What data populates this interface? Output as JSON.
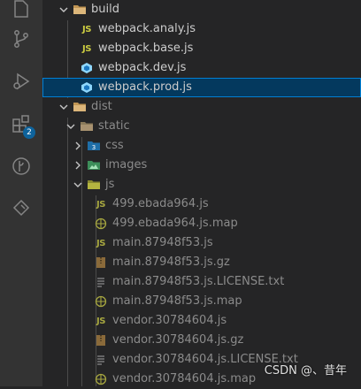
{
  "activity_bar": {
    "badge_count": "2"
  },
  "explorer": {
    "build_folder": "build",
    "build_files": [
      "webpack.analy.js",
      "webpack.base.js",
      "webpack.dev.js",
      "webpack.prod.js"
    ],
    "dist_folder": "dist",
    "static_folder": "static",
    "css_folder": "css",
    "images_folder": "images",
    "js_folder": "js",
    "js_files": [
      "499.ebada964.js",
      "499.ebada964.js.map",
      "main.87948f53.js",
      "main.87948f53.js.gz",
      "main.87948f53.js.LICENSE.txt",
      "main.87948f53.js.map",
      "vendor.30784604.js",
      "vendor.30784604.js.gz",
      "vendor.30784604.js.LICENSE.txt",
      "vendor.30784604.js.map"
    ]
  },
  "watermark": "CSDN @、昔年",
  "colors": {
    "js_yellow": "#cbcb41",
    "selection": "#04395e",
    "focus_border": "#007fd4",
    "badge_blue": "#0e639c"
  }
}
